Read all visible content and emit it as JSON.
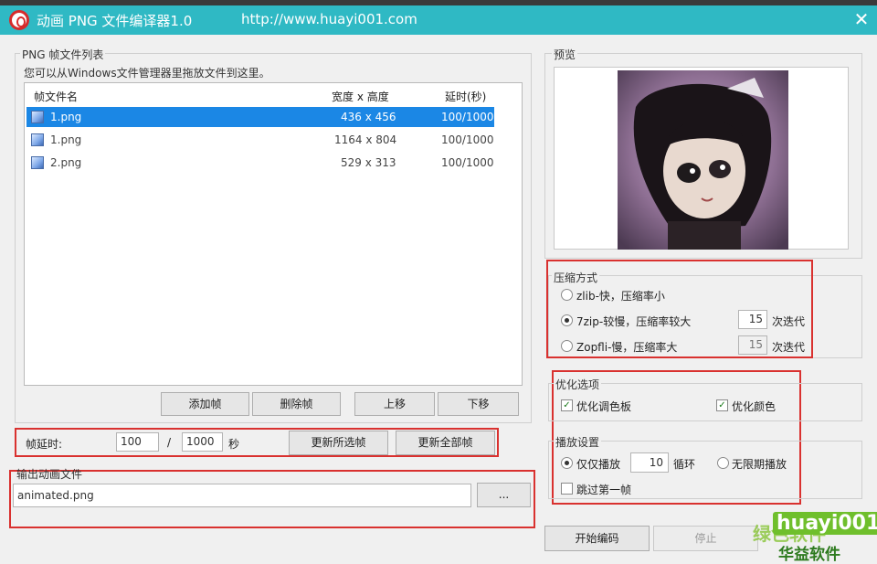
{
  "window": {
    "title": "动画 PNG 文件编译器1.0",
    "url": "http://www.huayi001.com",
    "close_glyph": "✕"
  },
  "frame_list": {
    "group_label": "PNG 帧文件列表",
    "hint": "您可以从Windows文件管理器里拖放文件到这里。",
    "columns": [
      "帧文件名",
      "宽度 x 高度",
      "延时(秒)"
    ],
    "rows": [
      {
        "name": "1.png",
        "size": "436 x 456",
        "delay": "100/1000",
        "selected": true
      },
      {
        "name": "1.png",
        "size": "1164 x 804",
        "delay": "100/1000",
        "selected": false
      },
      {
        "name": "2.png",
        "size": "529 x 313",
        "delay": "100/1000",
        "selected": false
      }
    ],
    "buttons": {
      "add": "添加帧",
      "delete": "删除帧",
      "up": "上移",
      "down": "下移"
    }
  },
  "delay": {
    "label": "帧延时:",
    "numerator": "100",
    "separator": "/",
    "denominator": "1000",
    "unit": "秒",
    "update_selected": "更新所选帧",
    "update_all": "更新全部帧"
  },
  "output": {
    "group_label": "输出动画文件",
    "filename": "animated.png",
    "browse": "..."
  },
  "preview": {
    "group_label": "预览"
  },
  "compression": {
    "group_label": "压缩方式",
    "options": [
      {
        "label": "zlib-快，压缩率小",
        "selected": false
      },
      {
        "label": "7zip-较慢，压缩率较大",
        "selected": true,
        "iterations": "15",
        "suffix": "次迭代"
      },
      {
        "label": "Zopfli-慢，压缩率大",
        "selected": false,
        "iterations": "15",
        "suffix": "次迭代"
      }
    ]
  },
  "optimize": {
    "group_label": "优化选项",
    "palette": {
      "label": "优化调色板",
      "checked": true
    },
    "color": {
      "label": "优化颜色",
      "checked": true
    }
  },
  "playback": {
    "group_label": "播放设置",
    "play_only": "仅仅播放",
    "loops": "10",
    "loop_unit": "循环",
    "infinite": "无限期播放",
    "skip_first": "跳过第一帧",
    "play_only_selected": true,
    "skip_first_checked": false
  },
  "actions": {
    "start": "开始编码",
    "stop": "停止"
  },
  "watermark": {
    "brand": "huayi001",
    "green": "绿色软件",
    "name": "华益软件"
  },
  "colors": {
    "titlebar": "#2fb9c4",
    "selection": "#1b87e5",
    "highlight_box": "#d9312f"
  }
}
